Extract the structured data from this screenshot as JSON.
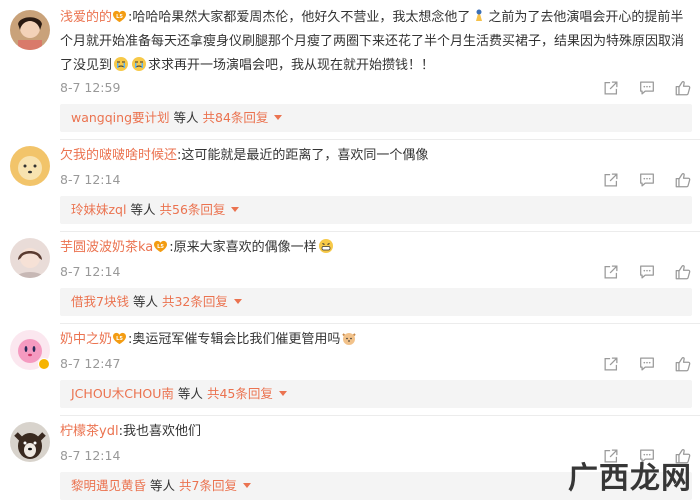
{
  "comments": [
    {
      "user": "浅爱的的",
      "text_part1": ":哈哈哈果然大家都爱周杰伦，他好久不营业，我太想念他了",
      "text_part2": "之前为了去他演唱会开心的提前半个月就开始准备每天还拿瘦身仪刷腿那个月瘦了两圈下来还花了半个月生活费买裙子，结果因为特殊原因取消了没见到",
      "text_part3": "求求再开一场演唱会吧，我从现在就开始攒钱！！",
      "time": "8-7 12:59",
      "reply": {
        "name": "wangqing要计划",
        "mid": "等人",
        "count": "共84条回复"
      }
    },
    {
      "user": "欠我的啵啵啥时候还",
      "text_part1": ":这可能就是最近的距离了，喜欢同一个偶像",
      "time": "8-7 12:14",
      "reply": {
        "name": "玲妹妹zql",
        "mid": "等人",
        "count": "共56条回复"
      }
    },
    {
      "user": "芋圆波波奶茶ka",
      "text_part1": ":原来大家喜欢的偶像一样",
      "time": "8-7 12:14",
      "reply": {
        "name": "借我7块钱",
        "mid": "等人",
        "count": "共32条回复"
      }
    },
    {
      "user": "奶中之奶",
      "text_part1": ":奥运冠军催专辑会比我们催更管用吗",
      "time": "8-7 12:47",
      "reply": {
        "name": "JCHOU木CHOU南",
        "mid": "等人",
        "count": "共45条回复"
      }
    },
    {
      "user": "柠檬茶ydl",
      "text_part1": ":我也喜欢他们",
      "time": "8-7 12:14",
      "reply": {
        "name": "黎明遇见黄昏",
        "mid": "等人",
        "count": "共7条回复"
      }
    }
  ],
  "watermark": {
    "text": "广西龙网"
  },
  "colors": {
    "username": "#eb7350",
    "time": "#999999",
    "reply_bg": "#f4f4f4"
  },
  "icons": [
    "share-icon",
    "comment-icon",
    "like-icon"
  ]
}
